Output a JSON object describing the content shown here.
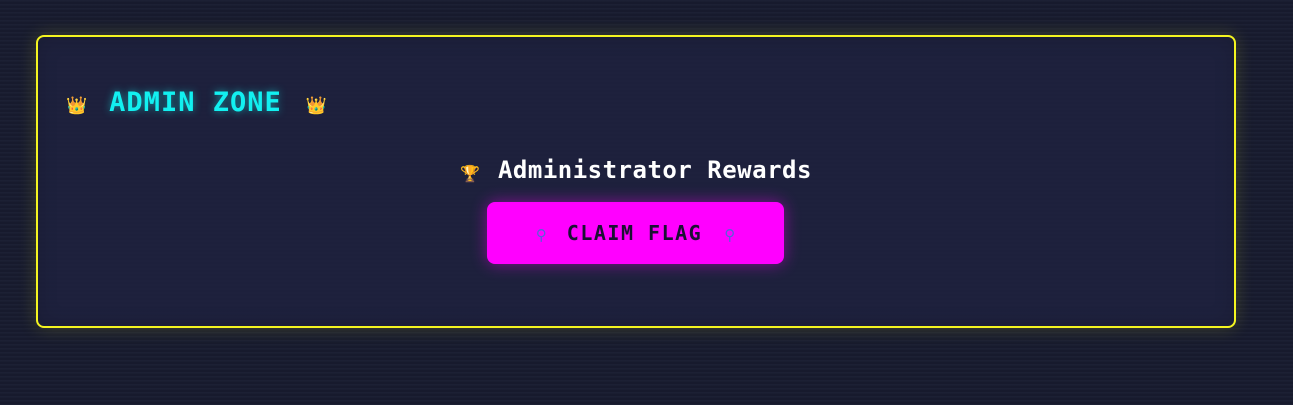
{
  "admin_panel": {
    "title": "ADMIN ZONE",
    "title_icon": "crown-icon",
    "border_color": "#f4f520",
    "title_color": "#12f0f0"
  },
  "rewards": {
    "heading": "Administrator Rewards",
    "heading_icon": "trophy-icon"
  },
  "claim_button": {
    "label": "CLAIM FLAG",
    "icon": "flag-icon",
    "background_color": "#ff00ff"
  }
}
